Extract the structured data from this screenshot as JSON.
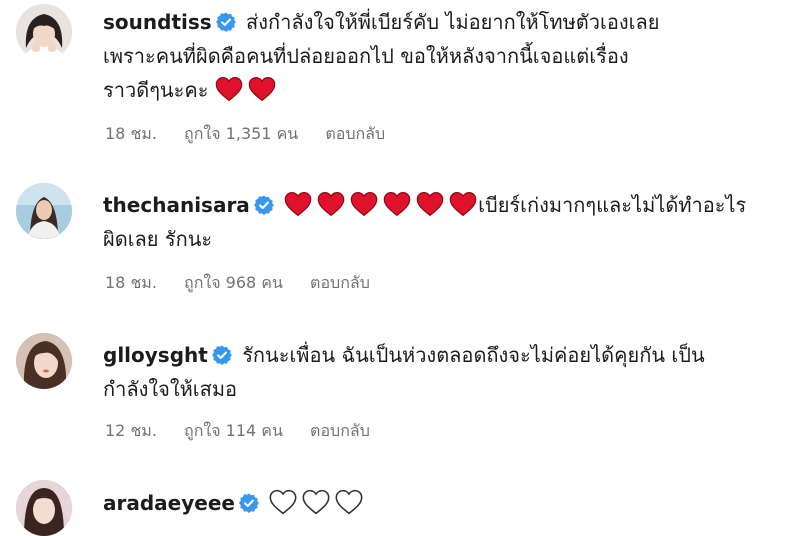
{
  "comments": [
    {
      "username": "soundtiss",
      "text_line1": "ส่งกำลังใจให้พี่เบียร์คับ ไม่อยากให้โทษตัวเองเลย",
      "text_line2": "เพราะคนที่ผิดคือคนที่ปล่อยออกไป ขอให้หลังจากนี้เจอแต่เรื่อง",
      "text_line3": "ราวดีๆนะคะ",
      "hearts_after": 2,
      "time": "18 ชม.",
      "likes": "ถูกใจ 1,351 คน",
      "reply": "ตอบกลับ"
    },
    {
      "username": "thechanisara",
      "hearts_before": 6,
      "text_line1": "เบียร์เก่งมากๆและไม่ได้ทำอะไร",
      "text_line2": "ผิดเลย รักนะ",
      "time": "18 ชม.",
      "likes": "ถูกใจ 968 คน",
      "reply": "ตอบกลับ"
    },
    {
      "username": "glloysght",
      "text_line1": "รักนะเพื่อน ฉันเป็นห่วงตลอดถึงจะไม่ค่อยได้คุยกัน เป็น",
      "text_line2": "กำลังใจให้เสมอ",
      "time": "12 ชม.",
      "likes": "ถูกใจ 114 คน",
      "reply": "ตอบกลับ"
    },
    {
      "username": "aradaeyeee",
      "outline_hearts": 3
    }
  ],
  "colors": {
    "verified": "#3897f0",
    "heart_red": "#e0112b",
    "meta_gray": "#737373"
  },
  "icons": {
    "verified": "verified-badge-icon",
    "heart": "red-heart-icon",
    "outline_heart": "white-heart-icon"
  }
}
